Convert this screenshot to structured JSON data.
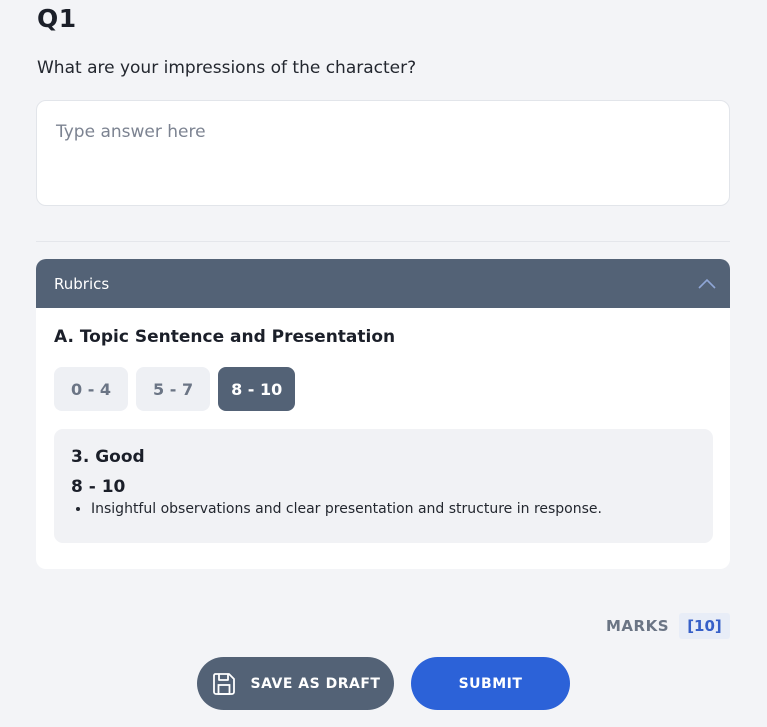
{
  "question": {
    "number": "Q1",
    "text": "What are your impressions of the character?",
    "answer_placeholder": "Type answer here",
    "answer_value": ""
  },
  "rubrics": {
    "header_label": "Rubrics",
    "expanded": true,
    "criterion_title": "A. Topic Sentence and Presentation",
    "ranges": [
      {
        "label": "0 - 4",
        "selected": false
      },
      {
        "label": "5 - 7",
        "selected": false
      },
      {
        "label": "8 - 10",
        "selected": true
      }
    ],
    "selected_level": {
      "name": "3. Good",
      "range": "8 - 10",
      "descriptors": [
        "Insightful observations and clear presentation and structure in response."
      ]
    }
  },
  "marks": {
    "label": "MARKS",
    "value": "[10]"
  },
  "actions": {
    "save_draft_label": "SAVE AS DRAFT",
    "submit_label": "SUBMIT"
  },
  "icons": {
    "rubric_toggle": "chevron-up-icon",
    "save_draft": "floppy-disk-icon"
  },
  "colors": {
    "background": "#f3f4f7",
    "header_slate": "#536276",
    "primary_blue": "#2c62d8",
    "marks_text": "#3760c8"
  }
}
